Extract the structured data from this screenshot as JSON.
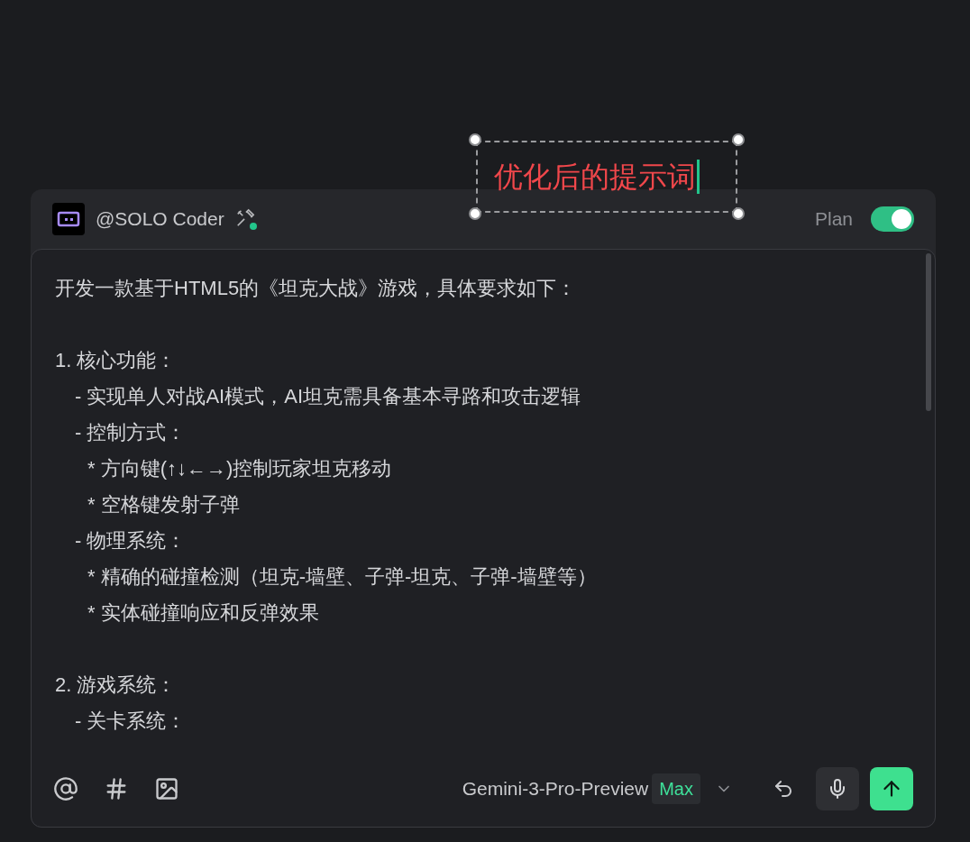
{
  "annotation": {
    "label": "优化后的提示词"
  },
  "agent": {
    "name": "@SOLO Coder",
    "tools_online": true
  },
  "plan": {
    "label": "Plan",
    "on": true
  },
  "prompt": {
    "intro": "开发一款基于HTML5的《坦克大战》游戏，具体要求如下：",
    "sections": [
      {
        "text": "1. 核心功能：",
        "children": [
          {
            "text": "- 实现单人对战AI模式，AI坦克需具备基本寻路和攻击逻辑"
          },
          {
            "text": "- 控制方式：",
            "children": [
              {
                "text": "* 方向键(↑↓←→)控制玩家坦克移动"
              },
              {
                "text": "* 空格键发射子弹"
              }
            ]
          },
          {
            "text": "- 物理系统：",
            "children": [
              {
                "text": "* 精确的碰撞检测（坦克-墙壁、子弹-坦克、子弹-墙壁等）"
              },
              {
                "text": "* 实体碰撞响应和反弹效果"
              }
            ]
          }
        ]
      },
      {
        "text": "2. 游戏系统：",
        "children": [
          {
            "text": "- 关卡系统："
          }
        ]
      }
    ]
  },
  "model": {
    "name": "Gemini-3-Pro-Preview",
    "tier": "Max"
  }
}
